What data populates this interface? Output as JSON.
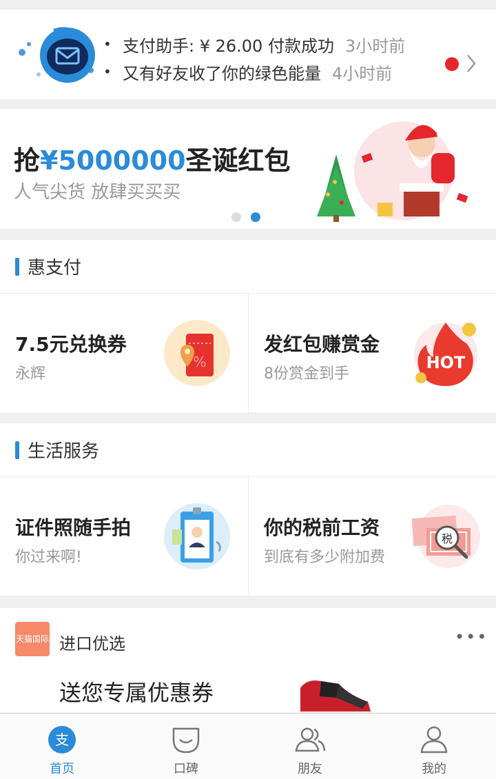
{
  "notifications": {
    "items": [
      {
        "text": "支付助手: ¥ 26.00 付款成功",
        "time": "3小时前"
      },
      {
        "text": "又有好友收了你的绿色能量",
        "time": "4小时前"
      }
    ],
    "unread_color": "#e5262c"
  },
  "banner": {
    "title_prefix": "抢",
    "title_amount": "¥5000000",
    "title_suffix": "圣诞红包",
    "subtitle": "人气尖货 放肆买买买",
    "page_count": 2,
    "active_page": 2
  },
  "hui_zhifu": {
    "title": "惠支付",
    "cards": [
      {
        "title": "7.5元兑换券",
        "subtitle": "永辉",
        "icon": "coupon-icon"
      },
      {
        "title": "发红包赚赏金",
        "subtitle": "8份赏金到手",
        "icon": "hot-icon",
        "icon_text": "HOT"
      }
    ]
  },
  "life_services": {
    "title": "生活服务",
    "cards": [
      {
        "title": "证件照随手拍",
        "subtitle": "你过来啊!",
        "icon": "id-photo-icon"
      },
      {
        "title": "你的税前工资",
        "subtitle": "到底有多少附加费",
        "icon": "tax-icon",
        "icon_text": "税"
      }
    ]
  },
  "promo": {
    "brand_logo": "天猫国际",
    "brand_name": "进口优选",
    "headline": "送您专属优惠券",
    "more": "•••"
  },
  "tabbar": {
    "tabs": [
      {
        "label": "首页",
        "icon": "home-zhi-icon",
        "active": true,
        "glyph": "支"
      },
      {
        "label": "口碑",
        "icon": "koubei-icon",
        "active": false
      },
      {
        "label": "朋友",
        "icon": "friends-icon",
        "active": false
      },
      {
        "label": "我的",
        "icon": "profile-icon",
        "active": false
      }
    ]
  },
  "colors": {
    "accent": "#2a8bd8",
    "hot_red": "#e83a2d"
  }
}
